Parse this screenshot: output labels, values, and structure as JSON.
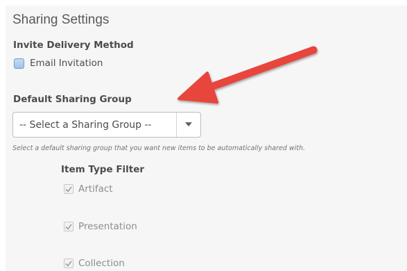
{
  "sharing_settings": {
    "title": "Sharing Settings",
    "invite_heading": "Invite Delivery Method",
    "email_invitation": {
      "label": "Email Invitation",
      "checked": true
    },
    "default_group_heading": "Default Sharing Group",
    "group_select": {
      "selected": "-- Select a Sharing Group --"
    },
    "help_text": "Select a default sharing group that you want new items to be automatically shared with.",
    "item_type_filter": {
      "heading": "Item Type Filter",
      "items": [
        {
          "label": "Artifact",
          "checked": true
        },
        {
          "label": "Presentation",
          "checked": true
        },
        {
          "label": "Collection",
          "checked": true
        }
      ]
    }
  },
  "colors": {
    "panel_bg": "#f6f6f6",
    "annotation_arrow": "#e8453c"
  },
  "icons": {
    "dropdown": "caret-down-icon",
    "annotation": "red-arrow-icon",
    "check": "checkmark-icon"
  }
}
